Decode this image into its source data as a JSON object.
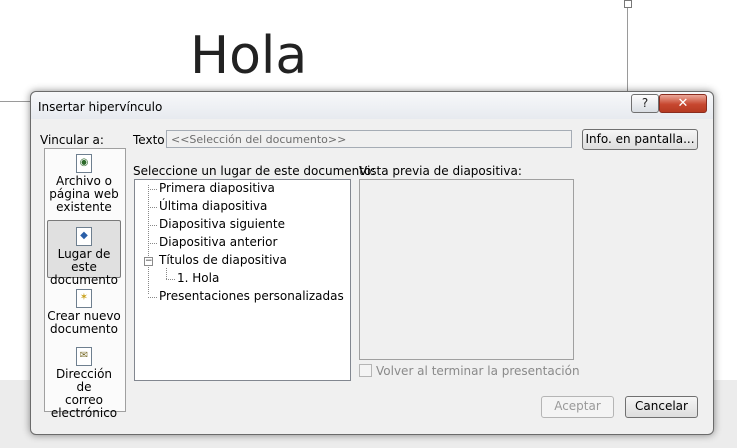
{
  "slide": {
    "title": "Hola"
  },
  "dialog": {
    "title": "Insertar hipervínculo",
    "help_label": "?",
    "close_label": "✕",
    "link_to_label": "Vincular a:",
    "text_label": "Texto:",
    "text_value": "<<Selección del documento>>",
    "screentip_button": "Info. en pantalla...",
    "sidebar": [
      {
        "label_lines": [
          "Archivo o",
          "página web",
          "existente"
        ],
        "icon": "file-web-icon",
        "selected": false
      },
      {
        "label_lines": [
          "Lugar de este",
          "documento"
        ],
        "icon": "document-place-icon",
        "selected": true
      },
      {
        "label_lines": [
          "Crear nuevo",
          "documento"
        ],
        "icon": "new-document-icon",
        "selected": false
      },
      {
        "label_lines": [
          "Dirección de",
          "correo",
          "electrónico"
        ],
        "icon": "email-icon",
        "selected": false
      }
    ],
    "place_label": "Seleccione un lugar de este documento:",
    "tree": [
      {
        "label": "Primera diapositiva"
      },
      {
        "label": "Última diapositiva"
      },
      {
        "label": "Diapositiva siguiente"
      },
      {
        "label": "Diapositiva anterior"
      },
      {
        "label": "Títulos de diapositiva",
        "expander": "−"
      },
      {
        "label": "1. Hola"
      },
      {
        "label": "Presentaciones personalizadas"
      }
    ],
    "preview_label": "Vista previa de diapositiva:",
    "return_checkbox_label": "Volver al terminar la presentación",
    "return_checked": false,
    "ok_button": "Aceptar",
    "cancel_button": "Cancelar"
  }
}
